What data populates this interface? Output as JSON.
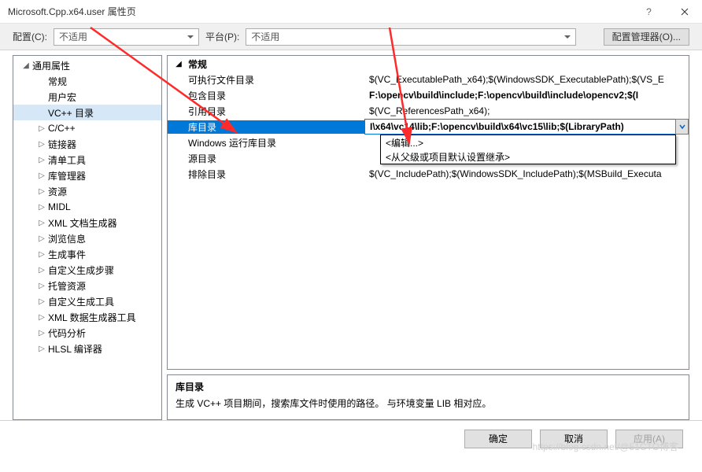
{
  "window": {
    "title": "Microsoft.Cpp.x64.user 属性页"
  },
  "toolbar": {
    "config_label": "配置(C):",
    "config_value": "不适用",
    "platform_label": "平台(P):",
    "platform_value": "不适用",
    "cfgmgr_label": "配置管理器(O)..."
  },
  "tree": {
    "root": "通用属性",
    "items": [
      {
        "label": "常规",
        "expandable": false
      },
      {
        "label": "用户宏",
        "expandable": false
      },
      {
        "label": "VC++ 目录",
        "expandable": false,
        "selected": true
      },
      {
        "label": "C/C++",
        "expandable": true
      },
      {
        "label": "链接器",
        "expandable": true
      },
      {
        "label": "清单工具",
        "expandable": true
      },
      {
        "label": "库管理器",
        "expandable": true
      },
      {
        "label": "资源",
        "expandable": true
      },
      {
        "label": "MIDL",
        "expandable": true
      },
      {
        "label": "XML 文档生成器",
        "expandable": true
      },
      {
        "label": "浏览信息",
        "expandable": true
      },
      {
        "label": "生成事件",
        "expandable": true
      },
      {
        "label": "自定义生成步骤",
        "expandable": true
      },
      {
        "label": "托管资源",
        "expandable": true
      },
      {
        "label": "自定义生成工具",
        "expandable": true
      },
      {
        "label": "XML 数据生成器工具",
        "expandable": true
      },
      {
        "label": "代码分析",
        "expandable": true
      },
      {
        "label": "HLSL 编译器",
        "expandable": true
      }
    ]
  },
  "grid": {
    "group": "常规",
    "rows": [
      {
        "name": "可执行文件目录",
        "value": "$(VC_ExecutablePath_x64);$(WindowsSDK_ExecutablePath);$(VS_E",
        "bold": false
      },
      {
        "name": "包含目录",
        "value": "F:\\opencv\\build\\include;F:\\opencv\\build\\include\\opencv2;$(I",
        "bold": true
      },
      {
        "name": "引用目录",
        "value": "$(VC_ReferencesPath_x64);",
        "bold": false
      },
      {
        "name": "库目录",
        "value": "I\\x64\\vc14\\lib;F:\\opencv\\build\\x64\\vc15\\lib;$(LibraryPath)",
        "selected": true
      },
      {
        "name": "Windows 运行库目录",
        "value": "",
        "bold": false
      },
      {
        "name": "源目录",
        "value": "",
        "bold": false
      },
      {
        "name": "排除目录",
        "value": "$(VC_IncludePath);$(WindowsSDK_IncludePath);$(MSBuild_Executa",
        "bold": false
      }
    ]
  },
  "popup": {
    "edit": "<编辑...>",
    "inherit": "<从父级或项目默认设置继承>"
  },
  "desc": {
    "title": "库目录",
    "text": "生成 VC++ 项目期间，搜索库文件时使用的路径。    与环境变量 LIB 相对应。"
  },
  "buttons": {
    "ok": "确定",
    "cancel": "取消",
    "apply": "应用(A)"
  },
  "watermark": "https://blog.csdn.net/@51CTO博客"
}
